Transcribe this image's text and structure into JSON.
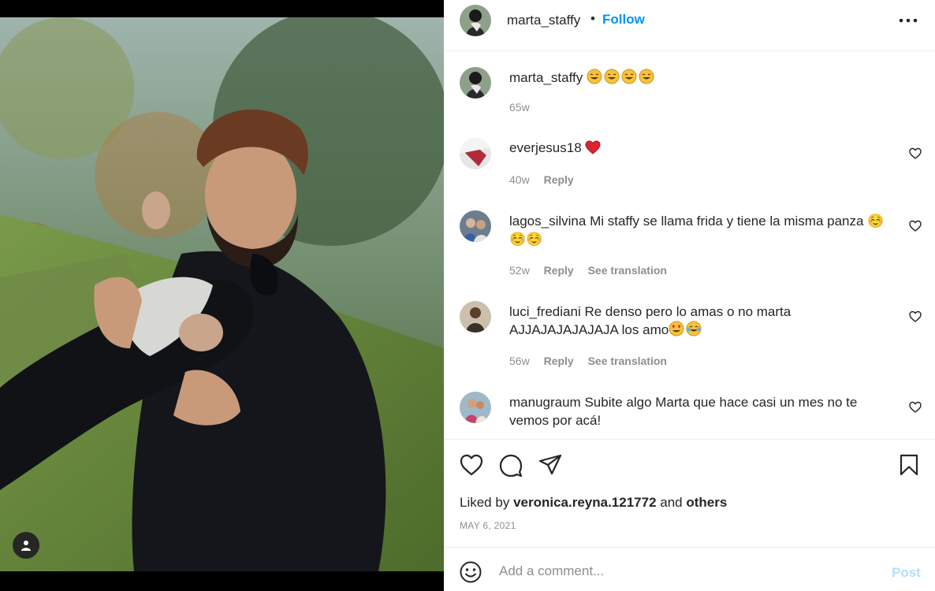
{
  "post": {
    "author": "marta_staffy",
    "follow_label": "Follow",
    "separator": "•",
    "caption": {
      "username": "marta_staffy",
      "emoji": [
        "grinning-face-with-blushing-eyes",
        "grinning-face-with-blushing-eyes",
        "grinning-face-with-blushing-eyes",
        "grinning-face-with-blushing-eyes"
      ],
      "age": "65w"
    },
    "comments": [
      {
        "username": "everjesus18",
        "text": "",
        "emoji": [
          "red-heart"
        ],
        "age": "40w",
        "reply": "Reply",
        "translate": ""
      },
      {
        "username": "lagos_silvina",
        "text": "Mi staffy se llama frida y tiene la misma panza ☺️☺️☺️",
        "emoji": [],
        "age": "52w",
        "reply": "Reply",
        "translate": "See translation"
      },
      {
        "username": "luci_frediani",
        "text": "Re denso pero lo amas o no marta AJJAJAJAJAJAJA los amo",
        "emoji": [
          "heart-eyes",
          "tears-of-joy"
        ],
        "age": "56w",
        "reply": "Reply",
        "translate": "See translation"
      },
      {
        "username": "manugraum",
        "text": "Subite algo Marta que hace casi un mes no te vemos por acá!",
        "emoji": [],
        "age": "",
        "reply": "",
        "translate": ""
      }
    ],
    "liked_by": {
      "prefix": "Liked by",
      "user": "veronica.reyna.121772",
      "joiner": "and",
      "others": "others"
    },
    "date": "MAY 6, 2021",
    "add_comment": {
      "placeholder": "Add a comment...",
      "post_label": "Post"
    }
  },
  "icons": {
    "header": [
      "more-options-icon"
    ],
    "actions": [
      "heart-icon",
      "comment-icon",
      "share-icon",
      "bookmark-icon"
    ],
    "composer": [
      "emoji-icon"
    ],
    "photo": [
      "user-tag-icon"
    ]
  },
  "colors": {
    "accent": "#0095f6",
    "text": "#262626",
    "muted": "#8e8e8e",
    "post_disabled": "#b2dffc"
  }
}
